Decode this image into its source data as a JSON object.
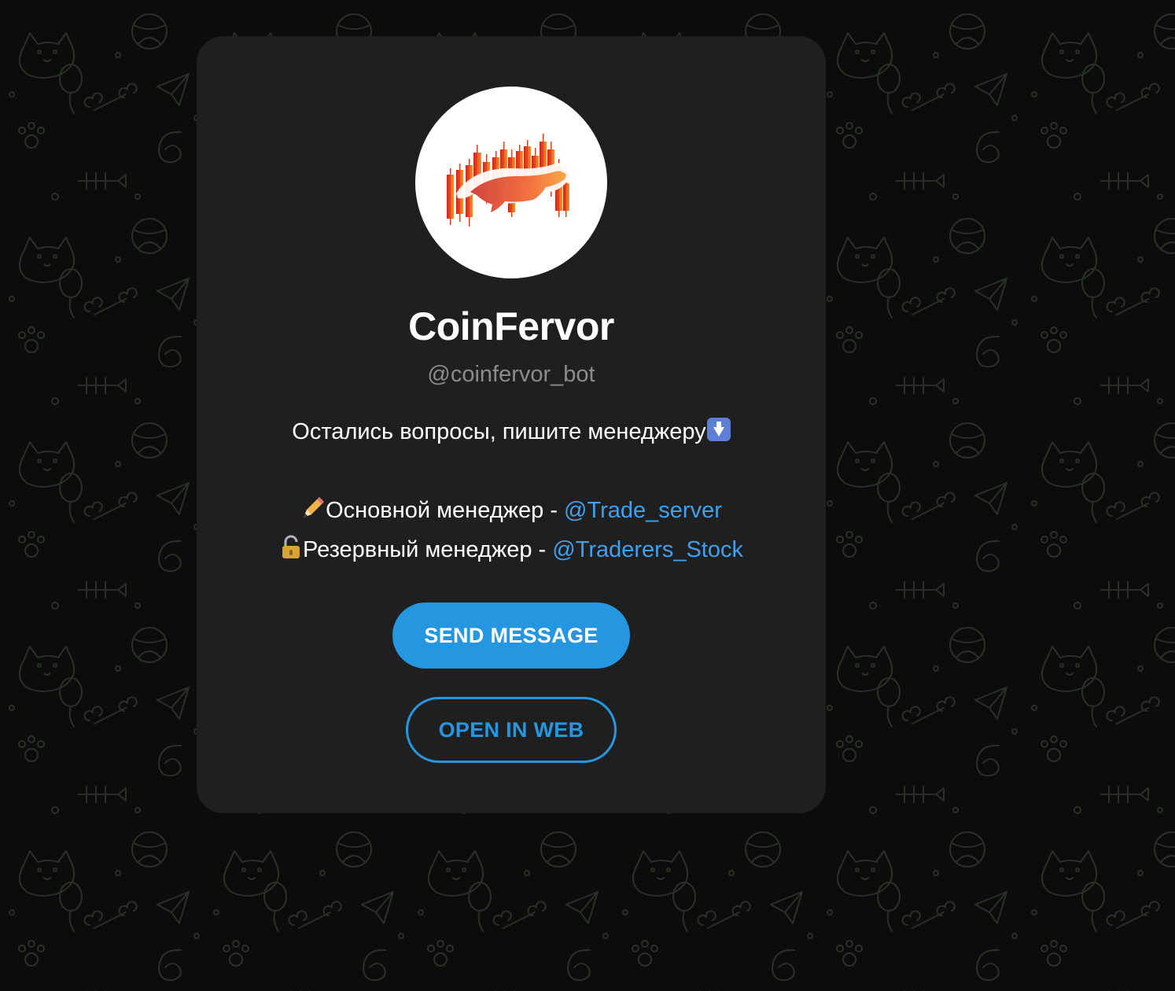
{
  "profile": {
    "name": "CoinFervor",
    "username": "@coinfervor_bot",
    "avatar_icon": "bull-candlestick-logo-icon"
  },
  "description": {
    "line1": "Остались вопросы, пишите менеджеру",
    "line1_emoji": "down-arrow-emoji-icon",
    "main_manager_label": "Основной менеджер - ",
    "main_manager_emoji": "pencil-emoji-icon",
    "main_manager_link": "@Trade_server",
    "reserve_manager_label": "Резервный менеджер - ",
    "reserve_manager_emoji": "lock-emoji-icon",
    "reserve_manager_link": "@Traderers_Stock"
  },
  "buttons": {
    "send_message": "SEND MESSAGE",
    "open_in_web": "OPEN IN WEB"
  },
  "colors": {
    "background": "#0b0c0b",
    "card": "#1f1f20",
    "accent": "#2596e0",
    "link": "#3fa0f0",
    "secondary_text": "#8c8c8e"
  }
}
